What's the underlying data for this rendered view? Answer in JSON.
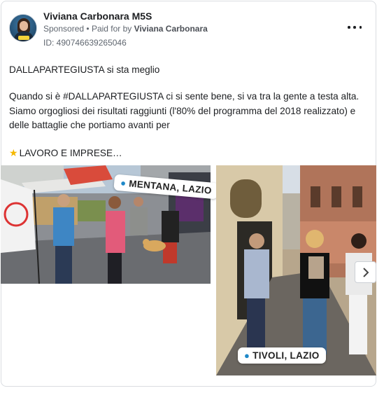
{
  "header": {
    "page_name": "Viviana Carbonara M5S",
    "sponsored": "Sponsored",
    "paid_for_prefix": "Paid for by",
    "paid_for_by": "Viviana Carbonara",
    "ad_id": "ID: 490746639265046"
  },
  "post": {
    "line_1": "DALLAPARTEGIUSTA si sta meglio",
    "paragraph_2": "Quando si è #DALLAPARTEGIUSTA ci si sente bene, si va tra la gente a testa alta. Siamo orgogliosi dei risultati raggiunti (l'80% del programma del 2018 realizzato) e delle battaglie che portiamo avanti per",
    "line_3": "LAVORO E IMPRESE…"
  },
  "images": [
    {
      "location": "MENTANA, LAZIO"
    },
    {
      "location": "TIVOLI, LAZIO"
    }
  ],
  "icons": {
    "more": "more-horizontal-icon",
    "star": "star-emoji-icon",
    "pin": "location-pin-icon",
    "next": "chevron-right-icon"
  },
  "colors": {
    "text": "#1c1e21",
    "secondary_text": "#606770",
    "pin_blue": "#1e88c8",
    "star_yellow": "#f5b800"
  }
}
